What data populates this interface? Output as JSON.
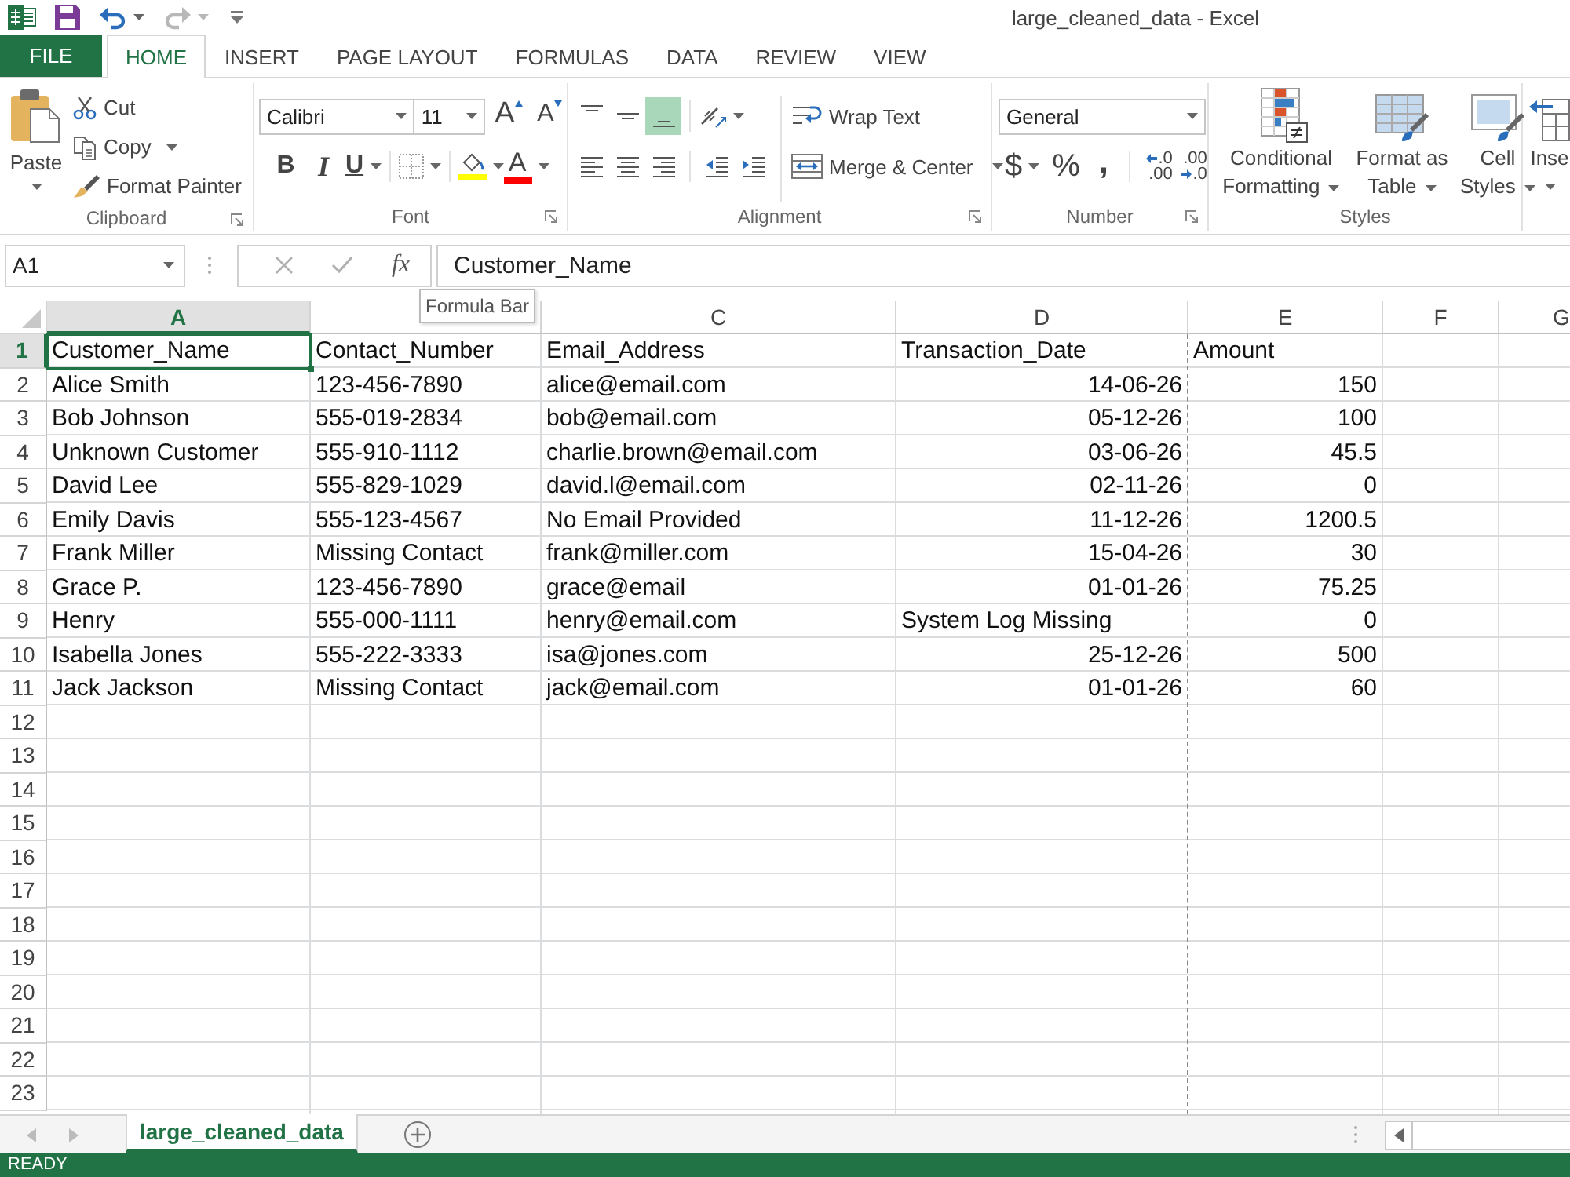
{
  "title_bar": {
    "title": "large_cleaned_data - Excel",
    "redo_disabled": true
  },
  "tabs": [
    {
      "label": "FILE",
      "kind": "file",
      "selected": false
    },
    {
      "label": "HOME",
      "kind": "tab",
      "selected": true
    },
    {
      "label": "INSERT",
      "kind": "tab",
      "selected": false
    },
    {
      "label": "PAGE LAYOUT",
      "kind": "tab",
      "selected": false
    },
    {
      "label": "FORMULAS",
      "kind": "tab",
      "selected": false
    },
    {
      "label": "DATA",
      "kind": "tab",
      "selected": false
    },
    {
      "label": "REVIEW",
      "kind": "tab",
      "selected": false
    },
    {
      "label": "VIEW",
      "kind": "tab",
      "selected": false
    }
  ],
  "ribbon": {
    "clipboard": {
      "label": "Clipboard",
      "paste": "Paste",
      "cut": "Cut",
      "copy": "Copy",
      "format_painter": "Format Painter"
    },
    "font": {
      "label": "Font",
      "font_name": "Calibri",
      "font_size": "11",
      "grow": "A",
      "shrink": "A",
      "bold": "B",
      "italic": "I",
      "underline": "U",
      "fill_color_button": {
        "color": "#ffff00"
      },
      "font_color_button": {
        "letter": "A",
        "color": "#ff0000"
      }
    },
    "alignment": {
      "label": "Alignment",
      "vertical": [
        {
          "kind": "top",
          "selected": false
        },
        {
          "kind": "middle",
          "selected": false
        },
        {
          "kind": "bottom",
          "selected": true
        }
      ],
      "horizontal": [
        {
          "kind": "left",
          "selected": false
        },
        {
          "kind": "center",
          "selected": false
        },
        {
          "kind": "right",
          "selected": false
        }
      ],
      "wrap_text": "Wrap Text",
      "merge_center": "Merge & Center"
    },
    "number": {
      "label": "Number",
      "format": "General",
      "currency": "$",
      "percent": "%",
      "comma": ",",
      "increase_decimal": [
        ".0",
        ".00"
      ],
      "decrease_decimal": [
        ".00",
        ".0"
      ]
    },
    "styles": {
      "label": "Styles",
      "conditional_formatting": "Conditional Formatting",
      "format_as_table": "Format as Table",
      "cell_styles": "Cell Styles"
    },
    "cells": {
      "insert": "Inse"
    }
  },
  "formula_bar": {
    "name_box": "A1",
    "editing": false,
    "function": "fx",
    "content": "Customer_Name",
    "tooltip": "Formula Bar"
  },
  "sheet": {
    "columns": [
      {
        "label": "A",
        "selected": true,
        "page_break": false
      },
      {
        "selected": false,
        "page_break": false
      },
      {
        "label": "C",
        "selected": false,
        "page_break": false
      },
      {
        "label": "D",
        "selected": false,
        "page_break": true
      },
      {
        "label": "E",
        "selected": false,
        "page_break": false
      },
      {
        "label": "F",
        "selected": false,
        "page_break": false
      },
      {
        "label": "G",
        "selected": false,
        "page_break": false
      }
    ],
    "rows": [
      {
        "header": "1",
        "selected": true,
        "cells": [
          {
            "value": "Customer_Name",
            "kind": "text"
          },
          {
            "value": "Contact_Number",
            "kind": "text"
          },
          {
            "value": "Email_Address",
            "kind": "text"
          },
          {
            "value": "Transaction_Date",
            "kind": "text"
          },
          {
            "value": "Amount",
            "kind": "text"
          }
        ]
      },
      {
        "header": "2",
        "selected": false,
        "cells": [
          {
            "value": "Alice Smith",
            "kind": "text"
          },
          {
            "value": "123-456-7890",
            "kind": "text"
          },
          {
            "value": "alice@email.com",
            "kind": "text"
          },
          {
            "value": "14-06-26",
            "kind": "number"
          },
          {
            "value": "150",
            "kind": "number"
          }
        ]
      },
      {
        "header": "3",
        "selected": false,
        "cells": [
          {
            "value": "Bob Johnson",
            "kind": "text"
          },
          {
            "value": "555-019-2834",
            "kind": "text"
          },
          {
            "value": "bob@email.com",
            "kind": "text"
          },
          {
            "value": "05-12-26",
            "kind": "number"
          },
          {
            "value": "100",
            "kind": "number"
          }
        ]
      },
      {
        "header": "4",
        "selected": false,
        "cells": [
          {
            "value": "Unknown Customer",
            "kind": "text"
          },
          {
            "value": "555-910-1112",
            "kind": "text"
          },
          {
            "value": "charlie.brown@email.com",
            "kind": "text"
          },
          {
            "value": "03-06-26",
            "kind": "number"
          },
          {
            "value": "45.5",
            "kind": "number"
          }
        ]
      },
      {
        "header": "5",
        "selected": false,
        "cells": [
          {
            "value": "David Lee",
            "kind": "text"
          },
          {
            "value": "555-829-1029",
            "kind": "text"
          },
          {
            "value": "david.l@email.com",
            "kind": "text"
          },
          {
            "value": "02-11-26",
            "kind": "number"
          },
          {
            "value": "0",
            "kind": "number"
          }
        ]
      },
      {
        "header": "6",
        "selected": false,
        "cells": [
          {
            "value": "Emily Davis",
            "kind": "text"
          },
          {
            "value": "555-123-4567",
            "kind": "text"
          },
          {
            "value": "No Email Provided",
            "kind": "text"
          },
          {
            "value": "11-12-26",
            "kind": "number"
          },
          {
            "value": "1200.5",
            "kind": "number"
          }
        ]
      },
      {
        "header": "7",
        "selected": false,
        "cells": [
          {
            "value": "Frank Miller",
            "kind": "text"
          },
          {
            "value": "Missing Contact",
            "kind": "text"
          },
          {
            "value": "frank@miller.com",
            "kind": "text"
          },
          {
            "value": "15-04-26",
            "kind": "number"
          },
          {
            "value": "30",
            "kind": "number"
          }
        ]
      },
      {
        "header": "8",
        "selected": false,
        "cells": [
          {
            "value": "Grace P.",
            "kind": "text"
          },
          {
            "value": "123-456-7890",
            "kind": "text"
          },
          {
            "value": "grace@email",
            "kind": "text"
          },
          {
            "value": "01-01-26",
            "kind": "number"
          },
          {
            "value": "75.25",
            "kind": "number"
          }
        ]
      },
      {
        "header": "9",
        "selected": false,
        "cells": [
          {
            "value": "Henry",
            "kind": "text"
          },
          {
            "value": "555-000-1111",
            "kind": "text"
          },
          {
            "value": "henry@email.com",
            "kind": "text"
          },
          {
            "value": "System Log Missing",
            "kind": "text"
          },
          {
            "value": "0",
            "kind": "number"
          }
        ]
      },
      {
        "header": "10",
        "selected": false,
        "cells": [
          {
            "value": "Isabella Jones",
            "kind": "text"
          },
          {
            "value": "555-222-3333",
            "kind": "text"
          },
          {
            "value": "isa@jones.com",
            "kind": "text"
          },
          {
            "value": "25-12-26",
            "kind": "number"
          },
          {
            "value": "500",
            "kind": "number"
          }
        ]
      },
      {
        "header": "11",
        "selected": false,
        "cells": [
          {
            "value": "Jack Jackson",
            "kind": "text"
          },
          {
            "value": "Missing Contact",
            "kind": "text"
          },
          {
            "value": "jack@email.com",
            "kind": "text"
          },
          {
            "value": "01-01-26",
            "kind": "number"
          },
          {
            "value": "60",
            "kind": "number"
          }
        ]
      },
      {
        "header": "12",
        "selected": false
      },
      {
        "header": "13",
        "selected": false
      },
      {
        "header": "14",
        "selected": false
      },
      {
        "header": "15",
        "selected": false
      },
      {
        "header": "16",
        "selected": false
      },
      {
        "header": "17",
        "selected": false
      },
      {
        "header": "18",
        "selected": false
      },
      {
        "header": "19",
        "selected": false
      },
      {
        "header": "20",
        "selected": false
      },
      {
        "header": "21",
        "selected": false
      },
      {
        "header": "22",
        "selected": false
      },
      {
        "header": "23",
        "selected": false
      }
    ]
  },
  "sheet_tabs": [
    {
      "label": "large_cleaned_data",
      "selected": true
    }
  ],
  "status_bar": {
    "text": "READY"
  }
}
